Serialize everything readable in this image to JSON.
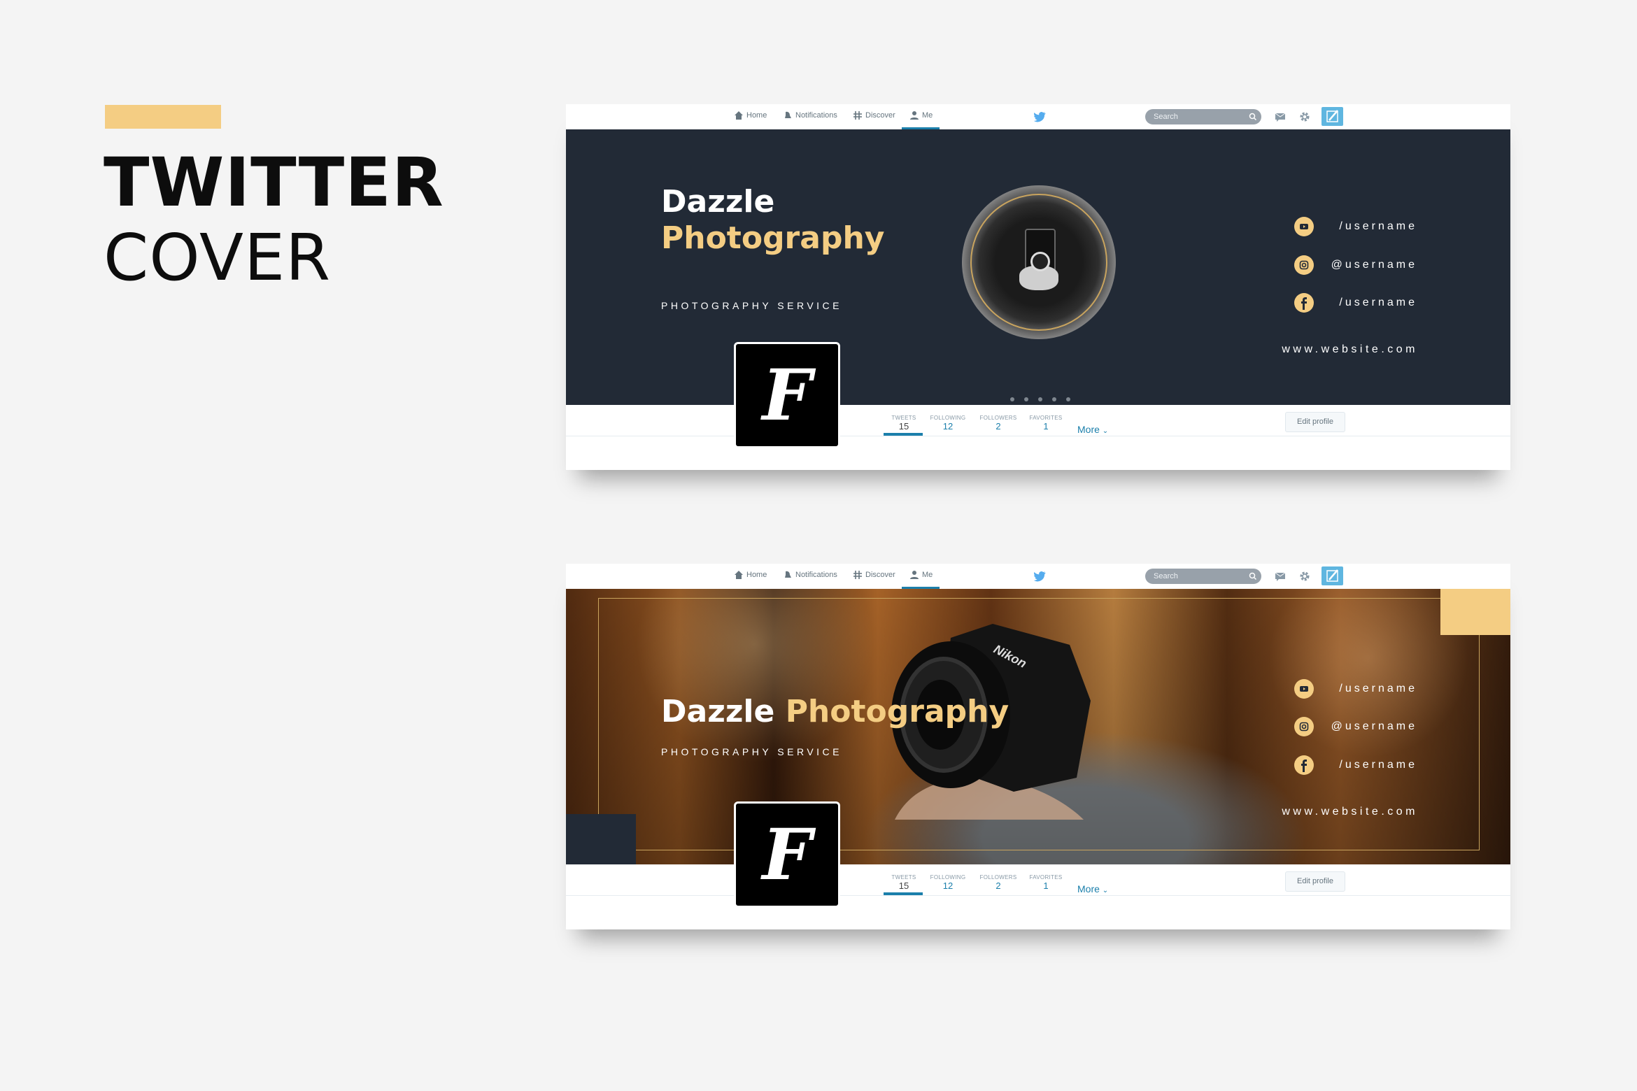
{
  "heading": {
    "line1": "TWITTER",
    "line2": "COVER",
    "accent_color": "#f4cd83"
  },
  "twitter_nav": {
    "items": [
      {
        "label": "Home",
        "icon": "home-icon"
      },
      {
        "label": "Notifications",
        "icon": "bell-icon"
      },
      {
        "label": "Discover",
        "icon": "hashtag-icon"
      },
      {
        "label": "Me",
        "icon": "user-icon"
      }
    ],
    "active": "Me",
    "search_placeholder": "Search"
  },
  "cards": [
    {
      "style": "dark-with-circle-photo",
      "title_white": "Dazzle",
      "title_gold": "Photography",
      "subtitle": "PHOTOGRAPHY SERVICE",
      "socials": [
        {
          "icon": "youtube-icon",
          "handle": "/username"
        },
        {
          "icon": "instagram-icon",
          "handle": "@username"
        },
        {
          "icon": "facebook-icon",
          "handle": "/username"
        }
      ],
      "website": "www.website.com",
      "avatar_letter": "F"
    },
    {
      "style": "photo-background",
      "title_white": "Dazzle ",
      "title_gold": "Photography",
      "subtitle": "PHOTOGRAPHY SERVICE",
      "socials": [
        {
          "icon": "youtube-icon",
          "handle": "/username"
        },
        {
          "icon": "instagram-icon",
          "handle": "@username"
        },
        {
          "icon": "facebook-icon",
          "handle": "/username"
        }
      ],
      "website": "www.website.com",
      "avatar_letter": "F",
      "camera_brand": "Nikon"
    }
  ],
  "profile_stats": [
    {
      "label": "TWEETS",
      "value": "15"
    },
    {
      "label": "FOLLOWING",
      "value": "12"
    },
    {
      "label": "FOLLOWERS",
      "value": "2"
    },
    {
      "label": "FAVORITES",
      "value": "1"
    }
  ],
  "more_label": "More",
  "edit_profile_label": "Edit profile",
  "colors": {
    "banner_dark": "#222a36",
    "gold": "#f4cd83",
    "twitter_blue": "#1b7fab"
  }
}
